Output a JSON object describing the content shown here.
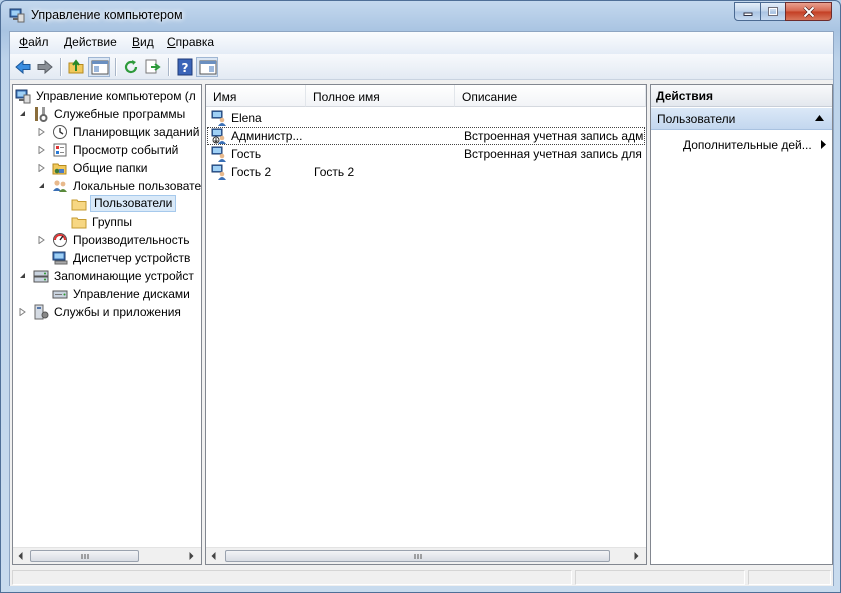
{
  "window": {
    "title": "Управление компьютером (локальным)",
    "title_visible": "Управление компьютером"
  },
  "menubar": {
    "items": [
      {
        "underline": "Ф",
        "rest": "айл"
      },
      {
        "underline": "Д",
        "rest": "ействие"
      },
      {
        "underline": "В",
        "rest": "ид"
      },
      {
        "underline": "С",
        "rest": "правка"
      }
    ]
  },
  "toolbar": {
    "buttons": [
      "back-icon",
      "forward-icon",
      "up-folder-icon",
      "show-hide-tree-icon",
      "refresh-icon",
      "export-list-icon",
      "help-icon",
      "show-hide-action-pane-icon"
    ]
  },
  "tree": {
    "items": [
      {
        "label": "Управление компьютером (л",
        "icon": "computer-management-icon",
        "level": 0,
        "expander": "none"
      },
      {
        "label": "Служебные программы",
        "icon": "tools-icon",
        "level": 1,
        "expander": "expanded"
      },
      {
        "label": "Планировщик заданий",
        "icon": "clock-icon",
        "level": 2,
        "expander": "collapsed"
      },
      {
        "label": "Просмотр событий",
        "icon": "event-viewer-icon",
        "level": 2,
        "expander": "collapsed"
      },
      {
        "label": "Общие папки",
        "icon": "shared-folder-icon",
        "level": 2,
        "expander": "collapsed"
      },
      {
        "label": "Локальные пользовате",
        "icon": "users-icon",
        "level": 2,
        "expander": "expanded"
      },
      {
        "label": "Пользователи",
        "icon": "folder-icon",
        "level": 3,
        "expander": "none",
        "selected": true
      },
      {
        "label": "Группы",
        "icon": "folder-icon",
        "level": 3,
        "expander": "none"
      },
      {
        "label": "Производительность",
        "icon": "performance-icon",
        "level": 2,
        "expander": "collapsed"
      },
      {
        "label": "Диспетчер устройств",
        "icon": "device-manager-icon",
        "level": 2,
        "expander": "none"
      },
      {
        "label": "Запоминающие устройст",
        "icon": "storage-icon",
        "level": 1,
        "expander": "expanded"
      },
      {
        "label": "Управление дисками",
        "icon": "disk-icon",
        "level": 2,
        "expander": "none"
      },
      {
        "label": "Службы и приложения",
        "icon": "services-icon",
        "level": 1,
        "expander": "collapsed"
      }
    ]
  },
  "list": {
    "columns": [
      "Имя",
      "Полное имя",
      "Описание"
    ],
    "rows": [
      {
        "name": "Elena",
        "full_name": "",
        "description": "",
        "disabled": false
      },
      {
        "name": "Администр...",
        "full_name": "",
        "description": "Встроенная учетная запись адм...",
        "disabled": true,
        "focused": true
      },
      {
        "name": "Гость",
        "full_name": "",
        "description": "Встроенная учетная запись для ...",
        "disabled": false
      },
      {
        "name": "Гость 2",
        "full_name": "Гость 2",
        "description": "",
        "disabled": false
      }
    ]
  },
  "actions": {
    "header": "Действия",
    "section": "Пользователи",
    "items": [
      "Дополнительные дей..."
    ]
  },
  "colors": {
    "selection_bg": "#d9e9f8",
    "section_bg": "#c3d7ef"
  }
}
